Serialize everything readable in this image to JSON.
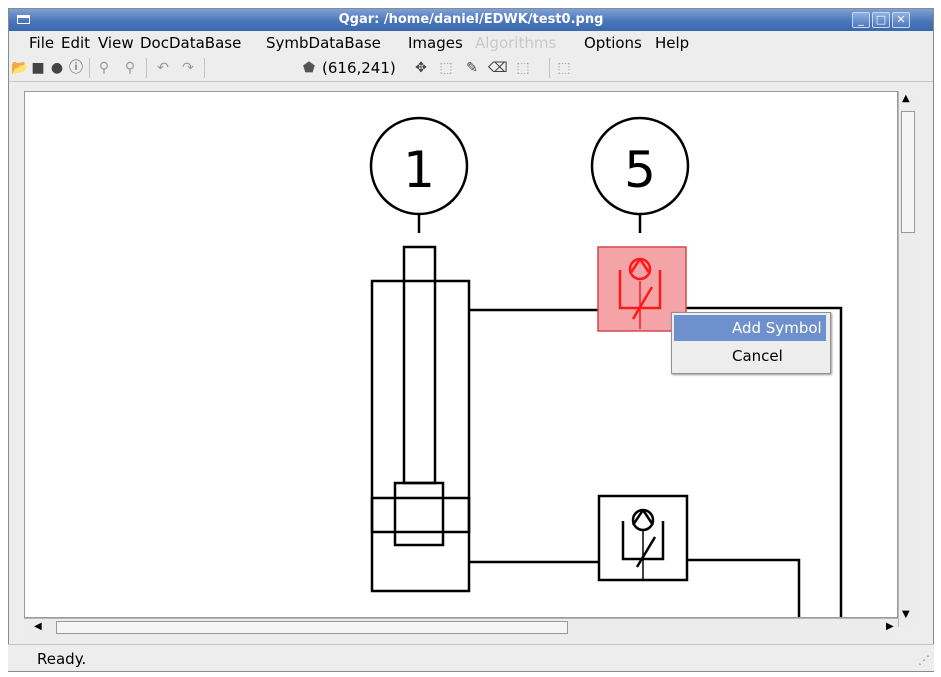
{
  "window": {
    "title": "Qgar: /home/daniel/EDWK/test0.png"
  },
  "menu": {
    "file": "File",
    "edit": "Edit",
    "view": "View",
    "docdb": "DocDataBase",
    "symbdb": "SymbDataBase",
    "images": "Images",
    "algorithms": "Algorithms",
    "options": "Options",
    "help": "Help"
  },
  "toolbar": {
    "coords": "(616,241)"
  },
  "canvas": {
    "symbol_labels": [
      "1",
      "5"
    ],
    "highlight_color": "#f4a3a6",
    "symbol_color": "#ff1a1a"
  },
  "context_menu": {
    "add": "Add Symbol",
    "cancel": "Cancel"
  },
  "status": {
    "message": "Ready."
  },
  "colors": {
    "titlebar": "#4a76bb",
    "menu_selection": "#6e90cc"
  }
}
